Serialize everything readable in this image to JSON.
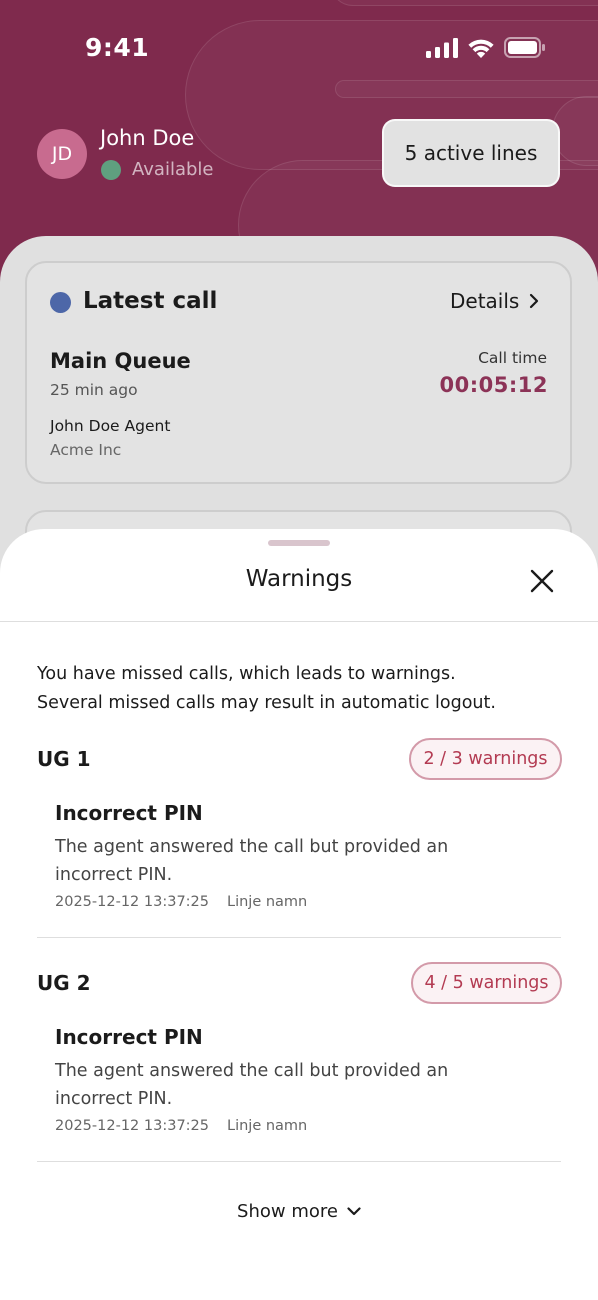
{
  "status_bar": {
    "time": "9:41",
    "icons": [
      "signal-icon",
      "wifi-icon",
      "battery-icon"
    ]
  },
  "user": {
    "initials": "JD",
    "name": "John Doe",
    "presence": "Available"
  },
  "active_lines": "5 active lines",
  "latest_call": {
    "title": "Latest call",
    "details_label": "Details",
    "queue": "Main Queue",
    "ago": "25 min ago",
    "agent": "John Doe Agent",
    "company": "Acme Inc",
    "call_time_label": "Call time",
    "call_time": "00:05:12"
  },
  "sheet": {
    "title": "Warnings",
    "intro_line1": "You have missed calls, which leads to warnings.",
    "intro_line2": "Several missed calls may result in automatic logout.",
    "groups": [
      {
        "name": "UG 1",
        "badge": "2 / 3 warnings",
        "item": {
          "title": "Incorrect PIN",
          "desc_line1": "The agent answered the call but provided an",
          "desc_line2": "incorrect PIN.",
          "datetime": "2025-12-12 13:37:25",
          "line": "Linje namn"
        }
      },
      {
        "name": "UG 2",
        "badge": "4 / 5 warnings",
        "item": {
          "title": "Incorrect PIN",
          "desc_line1": "The agent answered the call but provided an",
          "desc_line2": "incorrect PIN.",
          "datetime": "2025-12-12 13:37:25",
          "line": "Linje namn"
        }
      }
    ],
    "show_more": "Show more"
  },
  "colors": {
    "brand": "#7f2a4d",
    "accent_text": "#8c3357",
    "warning_text": "#b33b52",
    "presence_available": "#5fa07f",
    "latest_call_dot": "#4d67a8"
  }
}
